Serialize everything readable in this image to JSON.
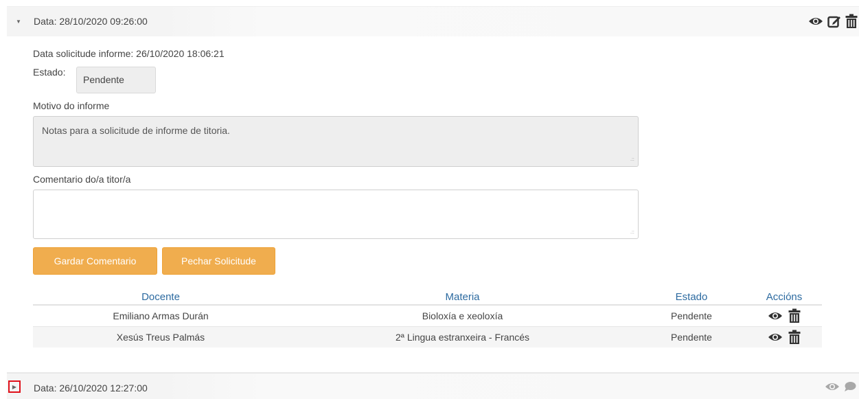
{
  "panel1": {
    "header": "Data: 28/10/2020 09:26:00",
    "icons": [
      "eye-icon",
      "edit-icon",
      "trash-icon"
    ],
    "fecha_solicitud": "Data solicitude informe: 26/10/2020 18:06:21",
    "estado_label": "Estado:",
    "estado_value": "Pendente",
    "motivo_label": "Motivo do informe",
    "motivo_value": "Notas para a solicitude de informe de titoria.",
    "comentario_label": "Comentario do/a titor/a",
    "comentario_value": "",
    "buttons": {
      "gardar": "Gardar Comentario",
      "pechar": "Pechar Solicitude"
    },
    "table": {
      "headers": [
        "Docente",
        "Materia",
        "Estado",
        "Accións"
      ],
      "rows": [
        {
          "docente": "Emiliano Armas Durán",
          "materia": "Bioloxía e xeoloxía",
          "estado": "Pendente"
        },
        {
          "docente": "Xesús Treus Palmás",
          "materia": "2ª Lingua estranxeira - Francés",
          "estado": "Pendente"
        }
      ]
    }
  },
  "panel2": {
    "header": "Data: 26/10/2020 12:27:00",
    "icons": [
      "eye-icon",
      "comment-icon"
    ]
  },
  "colors": {
    "accent_button": "#f0ad4e",
    "header_link": "#2c6aa0",
    "highlight": "#e0101a"
  }
}
